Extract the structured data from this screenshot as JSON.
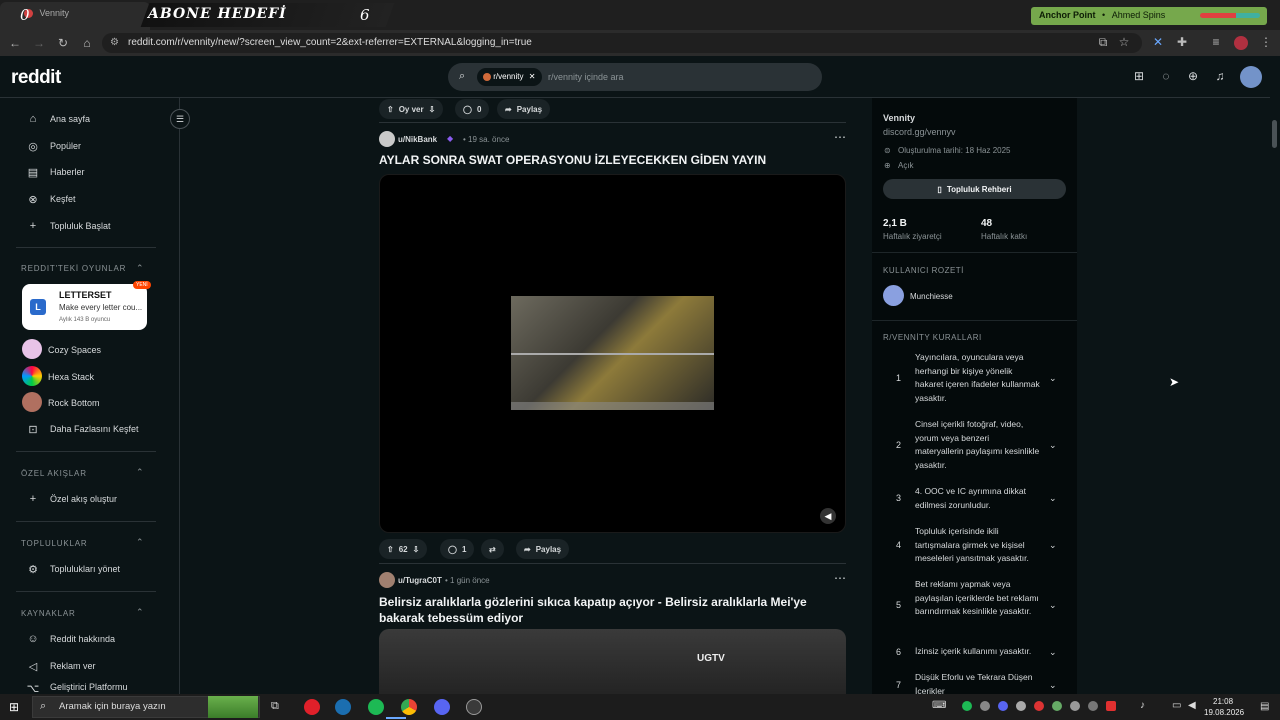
{
  "overlay": {
    "zero": "0",
    "tab_label": "Vennity",
    "abone_label": "ABONE HEDEFİ",
    "abone_count": "6",
    "anchor_label": "Anchor Point",
    "anchor_artist": "Ahmed Spins"
  },
  "browser": {
    "url": "reddit.com/r/vennity/new/?screen_view_count=2&ext-referrer=EXTERNAL&logging_in=true"
  },
  "header": {
    "logo": "reddit",
    "chip_label": "r/vennity",
    "search_placeholder": "r/vennity içinde ara"
  },
  "sidebar": {
    "nav": [
      {
        "label": "Ana sayfa",
        "icon": "home-icon"
      },
      {
        "label": "Popüler",
        "icon": "popular-icon"
      },
      {
        "label": "Haberler",
        "icon": "news-icon"
      },
      {
        "label": "Keşfet",
        "icon": "explore-icon"
      },
      {
        "label": "Topluluk Başlat",
        "icon": "plus-icon"
      }
    ],
    "games_heading": "REDDIT'TEKİ OYUNLAR",
    "featured_game": {
      "title": "LETTERSET",
      "desc": "Make every letter cou...",
      "meta": "Aylık 143 B oyuncu",
      "badge": "YENİ"
    },
    "games": [
      "Cozy Spaces",
      "Hexa Stack",
      "Rock Bottom"
    ],
    "games_more": "Daha Fazlasını Keşfet",
    "custom_heading": "ÖZEL AKIŞLAR",
    "custom_create": "Özel akış oluştur",
    "communities_heading": "TOPLULUKLAR",
    "communities_manage": "Toplulukları yönet",
    "resources_heading": "KAYNAKLAR",
    "resources": [
      "Reddit hakkında",
      "Reklam ver",
      "Geliştirici Platformu"
    ]
  },
  "feed": {
    "prev_actions": {
      "vote_label": "Oy ver",
      "comments": "0",
      "share": "Paylaş"
    },
    "post1": {
      "author": "u/NikBank",
      "time": "• 19 sa. önce",
      "title": "AYLAR SONRA SWAT OPERASYONU İZLEYECEKKEN GİDEN YAYIN",
      "votes": "62",
      "comments": "1",
      "share": "Paylaş"
    },
    "post2": {
      "author": "u/TugraC0T",
      "time": "• 1 gün önce",
      "title": "Belirsiz aralıklarla gözlerini sıkıca kapatıp açıyor - Belirsiz aralıklarla Mei'ye bakarak tebessüm ediyor",
      "watermark": "UGTV"
    }
  },
  "community": {
    "name": "Vennity",
    "link": "discord.gg/vennyv",
    "created": "Oluşturulma tarihi: 18 Haz 2025",
    "visibility": "Açık",
    "guide_button": "Topluluk Rehberi",
    "stats": [
      {
        "value": "2,1 B",
        "label": "Haftalık ziyaretçi"
      },
      {
        "value": "48",
        "label": "Haftalık katkı"
      }
    ],
    "badge_heading": "KULLANICI ROZETİ",
    "badge_user": "Munchiesse",
    "rules_heading": "R/VENNİTY KURALLARI",
    "rules": [
      {
        "num": "1",
        "text": "Yayıncılara, oyunculara veya herhangi bir kişiye yönelik hakaret içeren ifadeler kullanmak yasaktır."
      },
      {
        "num": "2",
        "text": "Cinsel içerikli fotoğraf, video, yorum veya benzeri materyallerin paylaşımı kesinlikle yasaktır."
      },
      {
        "num": "3",
        "text": "4. OOC ve IC ayrımına dikkat edilmesi zorunludur."
      },
      {
        "num": "4",
        "text": "Topluluk içerisinde ikili tartışmalara girmek ve kişisel meseleleri yansıtmak yasaktır."
      },
      {
        "num": "5",
        "text": "Bet reklamı yapmak veya paylaşılan içeriklerde bet reklamı barındırmak kesinlikle yasaktır."
      },
      {
        "num": "6",
        "text": "İzinsiz içerik kullanımı yasaktır."
      },
      {
        "num": "7",
        "text": "Düşük Eforlu ve Tekrara Düşen İçerikler"
      }
    ]
  },
  "taskbar": {
    "search_placeholder": "Aramak için buraya yazın",
    "time": "21:08",
    "date": "19.08.2026"
  }
}
